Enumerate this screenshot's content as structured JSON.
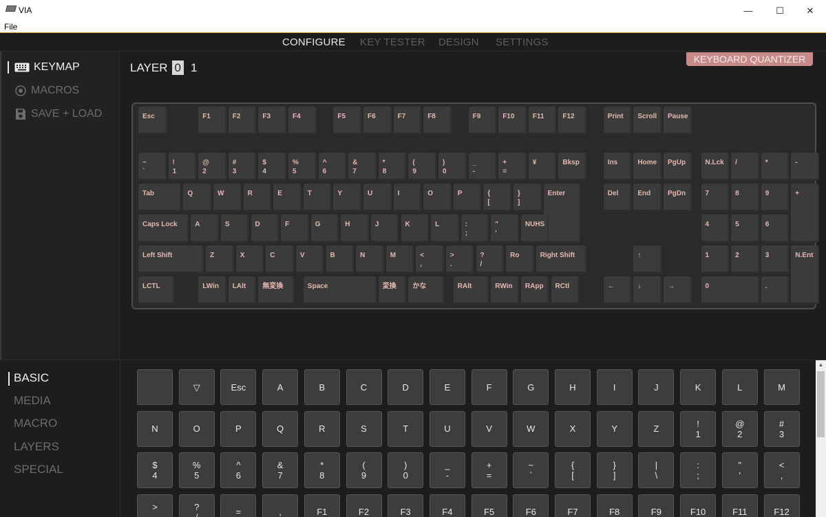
{
  "window": {
    "title": "VIA",
    "minimize": "—",
    "maximize": "☐",
    "close": "✕"
  },
  "menu": {
    "file": "File"
  },
  "nav": {
    "tabs": [
      "CONFIGURE",
      "KEY TESTER",
      "DESIGN",
      "SETTINGS"
    ],
    "active": "CONFIGURE"
  },
  "sidebar": {
    "items": [
      "KEYMAP",
      "MACROS",
      "SAVE + LOAD"
    ],
    "active": "KEYMAP"
  },
  "layer": {
    "label": "LAYER",
    "values": [
      "0",
      "1"
    ],
    "selected": "0"
  },
  "quantizer_button": "KEYBOARD QUANTIZER",
  "keyboard": {
    "rows": [
      [
        "Esc",
        "F1",
        "F2",
        "F3",
        "F4",
        "F5",
        "F6",
        "F7",
        "F8",
        "F9",
        "F10",
        "F11",
        "F12",
        "Print",
        "Scroll",
        "Pause"
      ],
      [
        "~\n`",
        "!\n1",
        "@\n2",
        "#\n3",
        "$\n4",
        "%\n5",
        "^\n6",
        "&\n7",
        "*\n8",
        "(\n9",
        ")\n0",
        "_\n-",
        "+\n=",
        "¥",
        "Bksp",
        "Ins",
        "Home",
        "PgUp",
        "N.Lck",
        "/",
        "*",
        "-"
      ],
      [
        "Tab",
        "Q",
        "W",
        "R",
        "E",
        "T",
        "Y",
        "U",
        "I",
        "O",
        "P",
        "{\n[",
        "}\n]",
        "Enter",
        "Del",
        "End",
        "PgDn",
        "7",
        "8",
        "9",
        "+"
      ],
      [
        "Caps Lock",
        "A",
        "S",
        "D",
        "F",
        "G",
        "H",
        "J",
        "K",
        "L",
        ":\n;",
        "\"\n'",
        "NUHS",
        "4",
        "5",
        "6"
      ],
      [
        "Left Shift",
        "Z",
        "X",
        "C",
        "V",
        "B",
        "N",
        "M",
        "<\n,",
        ">\n.",
        "?\n/",
        "Ro",
        "Right Shift",
        "↑",
        "1",
        "2",
        "3",
        "N.Ent"
      ],
      [
        "LCTL",
        "LWin",
        "LAlt",
        "無変換",
        "Space",
        "変換",
        "かな",
        "RAlt",
        "RWin",
        "RApp",
        "RCtl",
        "←",
        "↓",
        "→",
        "0",
        "."
      ]
    ]
  },
  "categories": {
    "items": [
      "BASIC",
      "MEDIA",
      "MACRO",
      "LAYERS",
      "SPECIAL"
    ],
    "active": "BASIC"
  },
  "palette": {
    "keys": [
      "",
      "▽",
      "Esc",
      "A",
      "B",
      "C",
      "D",
      "E",
      "F",
      "G",
      "H",
      "I",
      "J",
      "K",
      "L",
      "M",
      "N",
      "O",
      "P",
      "Q",
      "R",
      "S",
      "T",
      "U",
      "V",
      "W",
      "X",
      "Y",
      "Z",
      "!\n1",
      "@\n2",
      "#\n3",
      "$\n4",
      "%\n5",
      "^\n6",
      "&\n7",
      "*\n8",
      "(\n9",
      ")\n0",
      "_\n-",
      "+\n=",
      "~\n`",
      "{\n[",
      "}\n]",
      "|\n\\",
      ":\n;",
      "\"\n'",
      "<\n,",
      ">\n.",
      "?\n/",
      "=",
      ",",
      "F1",
      "F2",
      "F3",
      "F4",
      "F5",
      "F6",
      "F7",
      "F8",
      "F9",
      "F10",
      "F11",
      "F12"
    ]
  }
}
